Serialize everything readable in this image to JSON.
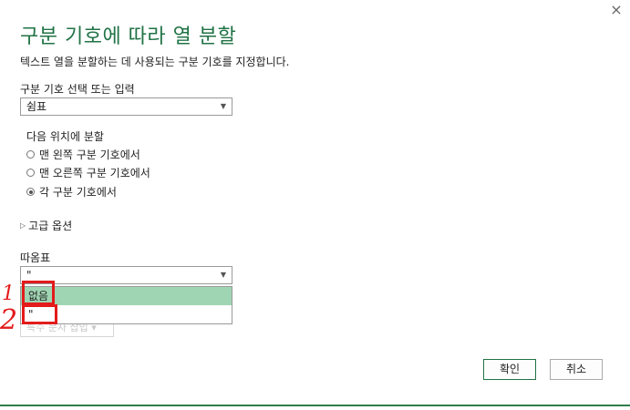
{
  "dialog": {
    "close_icon": "×",
    "title": "구분 기호에 따라 열 분할",
    "subtitle": "텍스트 열을 분할하는 데 사용되는 구분 기호를 지정합니다."
  },
  "delimiter": {
    "label": "구분 기호 선택 또는 입력",
    "value": "쉼표"
  },
  "split_at": {
    "label": "다음 위치에 분할",
    "options": [
      {
        "label": "맨 왼쪽 구분 기호에서",
        "checked": false
      },
      {
        "label": "맨 오른쪽 구분 기호에서",
        "checked": false
      },
      {
        "label": "각 구분 기호에서",
        "checked": true
      }
    ]
  },
  "advanced": {
    "label": "고급 옵션"
  },
  "quote": {
    "label": "따옴표",
    "value": "\"",
    "dropdown_options": [
      "없음",
      "\""
    ],
    "highlighted_option": "없음"
  },
  "special_char_button": {
    "label": "특수 문자 삽입"
  },
  "buttons": {
    "ok": "확인",
    "cancel": "취소"
  },
  "annotations": {
    "mark1": "1",
    "mark2": "2"
  },
  "colors": {
    "accent": "#217346",
    "highlight": "#a0d5b3",
    "annotation": "#e31b1b"
  }
}
